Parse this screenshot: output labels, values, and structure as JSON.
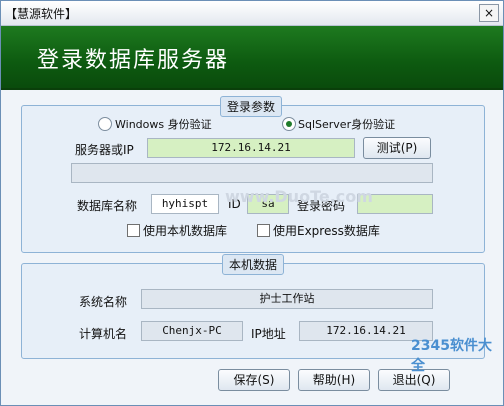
{
  "window": {
    "title": "【慧源软件】",
    "close_label": "×"
  },
  "banner": {
    "heading": "登录数据库服务器"
  },
  "login_params": {
    "legend": "登录参数",
    "auth_windows": "Windows  身份验证",
    "auth_sql": "SqlServer身份验证",
    "selected": "sql",
    "server_label": "服务器或IP",
    "server_value": "172.16.14.21",
    "test_button": "测试(P)",
    "db_name_label": "数据库名称",
    "db_name_value": "hyhispt",
    "id_label": "ID",
    "id_value": "sa",
    "password_label": "登录密码",
    "password_value": "",
    "use_local_db": "使用本机数据库",
    "use_express_db": "使用Express数据库"
  },
  "local_data": {
    "legend": "本机数据",
    "system_name_label": "系统名称",
    "system_name_value": "护士工作站",
    "computer_name_label": "计算机名",
    "computer_name_value": "Chenjx-PC",
    "ip_label": "IP地址",
    "ip_value": "172.16.14.21"
  },
  "buttons": {
    "save": "保存(S)",
    "help": "帮助(H)",
    "exit": "退出(Q)"
  },
  "watermark": {
    "brand": "2345软件大全",
    "url": "www.DuoTe.com"
  }
}
